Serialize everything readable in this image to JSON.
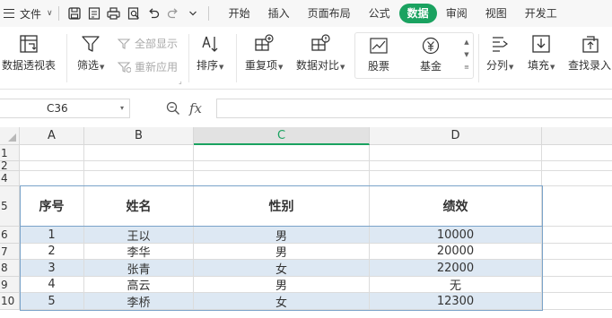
{
  "menubar": {
    "file_label": "文件",
    "tabs": [
      "开始",
      "插入",
      "页面布局",
      "公式",
      "数据",
      "审阅",
      "视图",
      "开发工"
    ],
    "active_tab": "数据"
  },
  "ribbon": {
    "pivot": "数据透视表",
    "filter": "筛选",
    "show_all": "全部显示",
    "reapply": "重新应用",
    "sort": "排序",
    "duplicates": "重复项",
    "compare": "数据对比",
    "stocks": "股票",
    "fund": "基金",
    "split": "分列",
    "fill": "填充",
    "lookup": "查找录入"
  },
  "formula_bar": {
    "cell_ref": "C36",
    "fx": "fx",
    "formula": ""
  },
  "sheet": {
    "columns": [
      "A",
      "B",
      "C",
      "D"
    ],
    "selected_column": "C",
    "rows": [
      "1",
      "2",
      "4",
      "5",
      "6",
      "7",
      "8",
      "9",
      "10"
    ],
    "table_headers": [
      "序号",
      "姓名",
      "性别",
      "绩效"
    ],
    "table_rows": [
      [
        "1",
        "王以",
        "男",
        "10000"
      ],
      [
        "2",
        "李华",
        "男",
        "20000"
      ],
      [
        "3",
        "张青",
        "女",
        "22000"
      ],
      [
        "4",
        "高云",
        "男",
        "无"
      ],
      [
        "5",
        "李桥",
        "女",
        "12300"
      ]
    ]
  },
  "colors": {
    "accent": "#1aa260",
    "row_shade": "#dde8f3",
    "table_border": "#7aa3c9"
  }
}
